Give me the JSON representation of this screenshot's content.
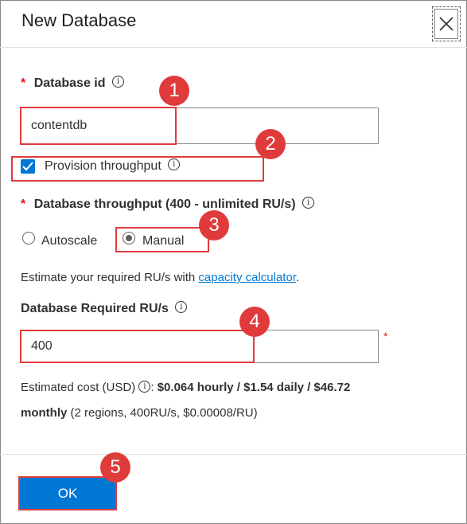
{
  "dialog": {
    "title": "New Database",
    "close_label": "close"
  },
  "database_id": {
    "label": "Database id",
    "required_mark": "*",
    "value": "contentdb"
  },
  "provision": {
    "label": "Provision throughput",
    "checked": true
  },
  "throughput": {
    "label": "Database throughput (400 - unlimited RU/s)",
    "required_mark": "*",
    "options": [
      "Autoscale",
      "Manual"
    ],
    "selected": "Manual"
  },
  "estimate": {
    "prefix": "Estimate your required RU/s with ",
    "link": "capacity calculator",
    "suffix": "."
  },
  "required_rus": {
    "label": "Database Required RU/s",
    "value": "400",
    "required_mark": "*"
  },
  "cost": {
    "prefix": "Estimated cost (USD) ",
    "colon": ":",
    "bold_1": "$0.064 hourly / $1.54 daily / $46.72",
    "bold_2": "monthly",
    "detail": " (2 regions, 400RU/s, $0.00008/RU)"
  },
  "footer": {
    "ok_label": "OK"
  },
  "callouts": [
    "1",
    "2",
    "3",
    "4",
    "5"
  ],
  "colors": {
    "accent": "#0078d4",
    "callout": "#e03b3b",
    "required": "#e81123"
  }
}
